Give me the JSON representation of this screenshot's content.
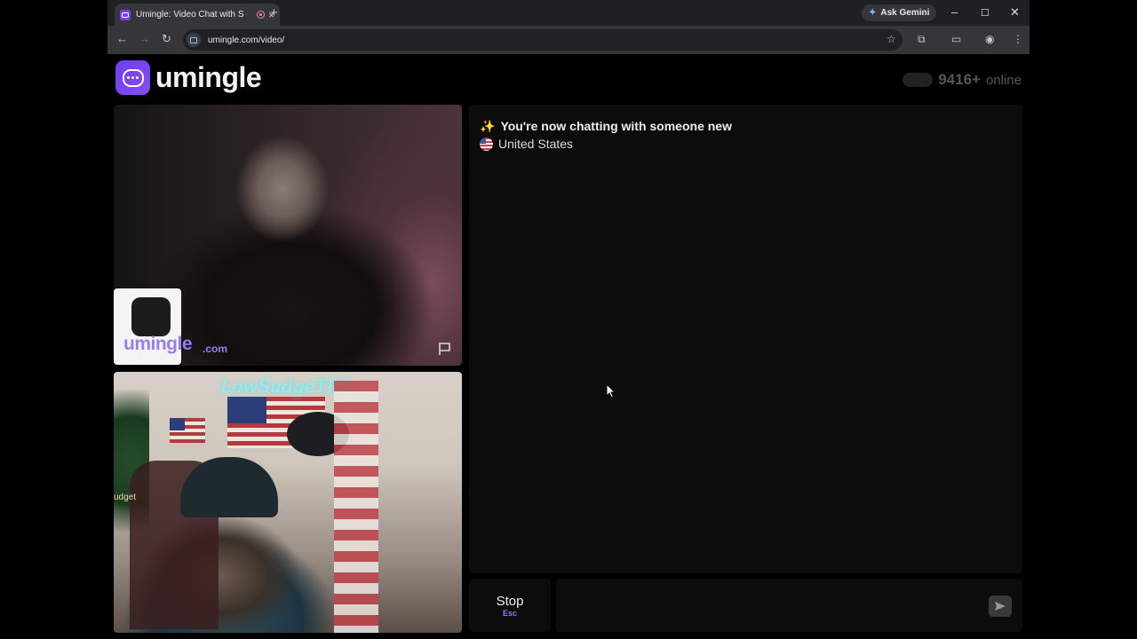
{
  "browser": {
    "tab_title": "Umingle: Video Chat with S",
    "tab_close": "×",
    "new_tab": "+",
    "gemini_label": "Ask Gemini",
    "url": "umingle.com/video/",
    "window_controls": {
      "minimize": "–",
      "maximize": "☐",
      "close": "✕"
    },
    "nav": {
      "back": "←",
      "forward": "→",
      "reload": "↻"
    },
    "icons": {
      "star": "☆",
      "extensions": "⧉",
      "menu": "⋮"
    }
  },
  "site": {
    "logo_text": "umingle",
    "online_count": "9416+",
    "online_label": "online"
  },
  "remote_video": {
    "watermark_text": "umingle",
    "watermark_suffix": ".com"
  },
  "local_video": {
    "neon_sign": "LowSudgeTRS",
    "background_text": "udget"
  },
  "chat": {
    "sparkle": "✨",
    "status_message": "You're now chatting with someone new",
    "country": "United States"
  },
  "controls": {
    "stop_label": "Stop",
    "stop_key": "Esc",
    "message_placeholder": "",
    "send_icon": "send-icon"
  },
  "colors": {
    "brand_purple": "#7b3ff2",
    "accent_purple": "#9b7cf0",
    "background": "#000000",
    "panel": "#0c0c0c"
  }
}
